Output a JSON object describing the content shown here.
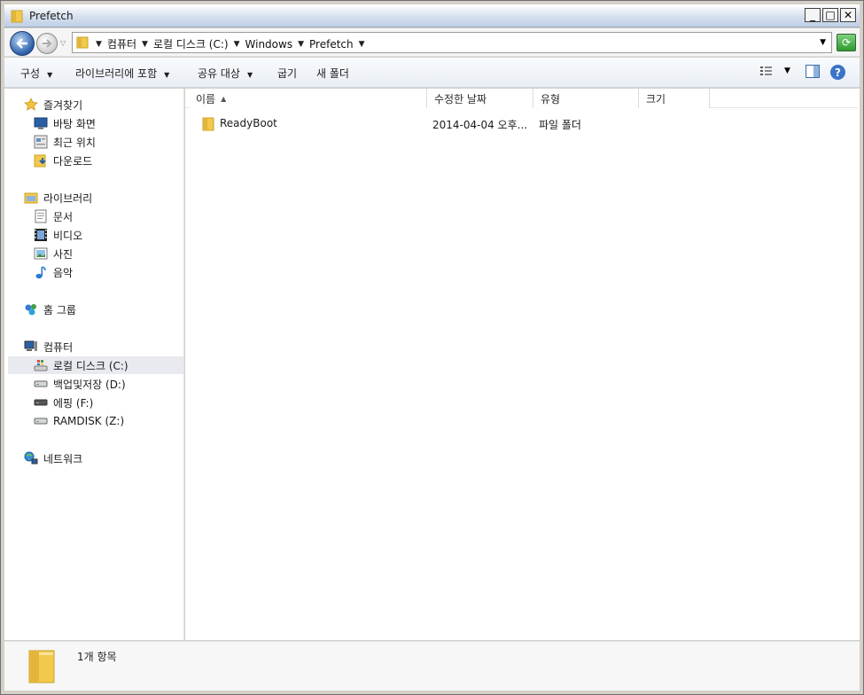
{
  "window": {
    "title": "Prefetch"
  },
  "address": {
    "breadcrumbs": [
      "컴퓨터",
      "로컬 디스크 (C:)",
      "Windows",
      "Prefetch"
    ]
  },
  "toolbar": {
    "organize": "구성",
    "include_in_library": "라이브러리에 포함",
    "share_with": "공유 대상",
    "burn": "굽기",
    "new_folder": "새 폴더"
  },
  "sidebar": {
    "favorites": {
      "label": "즐겨찾기",
      "items": [
        "바탕 화면",
        "최근 위치",
        "다운로드"
      ]
    },
    "libraries": {
      "label": "라이브러리",
      "items": [
        "문서",
        "비디오",
        "사진",
        "음악"
      ]
    },
    "homegroup": {
      "label": "홈 그룹"
    },
    "computer": {
      "label": "컴퓨터",
      "items": [
        "로컬 디스크 (C:)",
        "백업및저장 (D:)",
        "에핑 (F:)",
        "RAMDISK (Z:)"
      ]
    },
    "network": {
      "label": "네트워크"
    }
  },
  "columns": {
    "name": "이름",
    "modified": "수정한 날짜",
    "type": "유형",
    "size": "크기"
  },
  "files": [
    {
      "name": "ReadyBoot",
      "modified": "2014-04-04 오후...",
      "type": "파일 폴더",
      "size": ""
    }
  ],
  "status": {
    "item_count": "1개 항목"
  },
  "colors": {
    "accent": "#2a5ea8",
    "folder": "#f2c94c",
    "selection": "#e8eaf0"
  },
  "icons": {
    "back": "arrow-left-icon",
    "forward": "arrow-right-icon",
    "folder": "folder-icon",
    "refresh": "refresh-icon",
    "views": "view-details-icon",
    "preview": "preview-pane-icon",
    "help": "help-icon"
  }
}
